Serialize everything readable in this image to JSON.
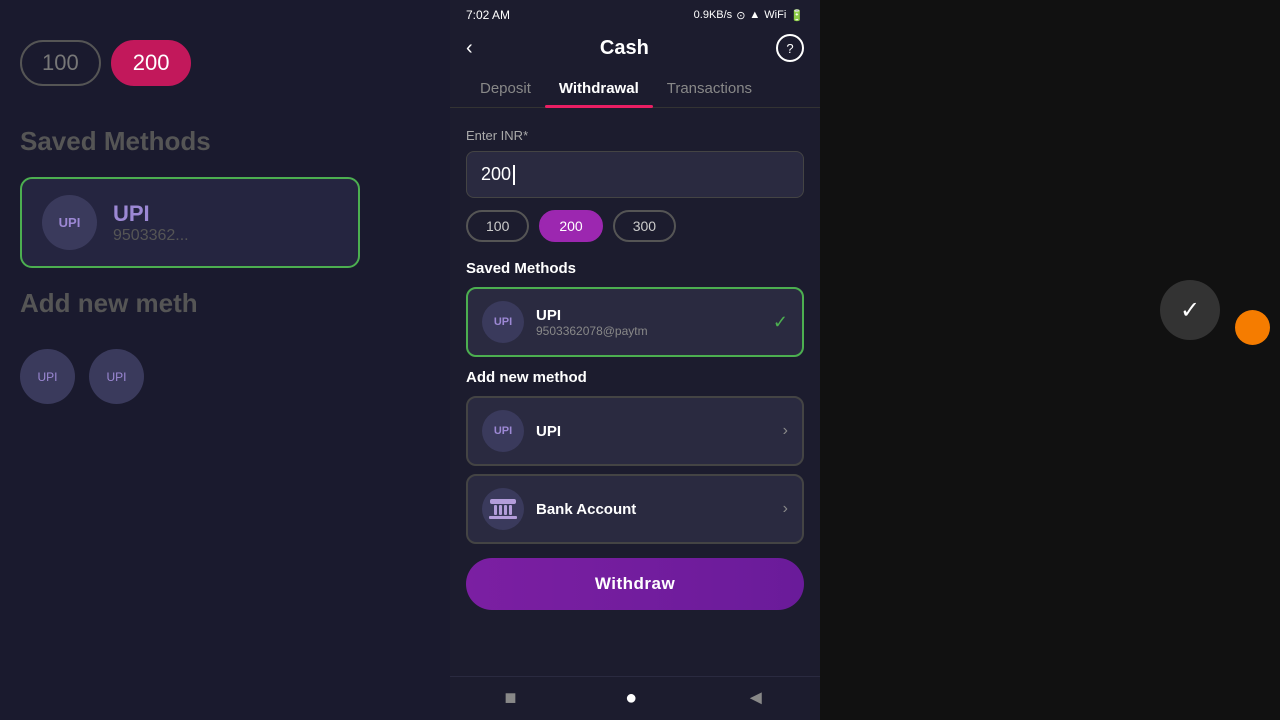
{
  "statusBar": {
    "time": "7:02 AM",
    "network": "0.9KB/s",
    "batteryLevel": "66"
  },
  "header": {
    "title": "Cash",
    "backLabel": "‹",
    "helpLabel": "?"
  },
  "tabs": [
    {
      "label": "Deposit",
      "active": false
    },
    {
      "label": "Withdrawal",
      "active": true
    },
    {
      "label": "Transactions",
      "active": false
    }
  ],
  "form": {
    "amountLabel": "Enter INR*",
    "amountValue": "200",
    "quickAmounts": [
      {
        "value": "100",
        "selected": false
      },
      {
        "value": "200",
        "selected": true
      },
      {
        "value": "300",
        "selected": false
      }
    ]
  },
  "savedMethods": {
    "title": "Saved Methods",
    "items": [
      {
        "icon": "UPI",
        "name": "UPI",
        "sub": "9503362078@paytm",
        "selected": true
      }
    ]
  },
  "addNewMethod": {
    "title": "Add new method",
    "items": [
      {
        "icon": "UPI",
        "name": "UPI",
        "type": "upi"
      },
      {
        "icon": "bank",
        "name": "Bank Account",
        "type": "bank"
      }
    ]
  },
  "withdrawButton": {
    "label": "Withdraw"
  },
  "bottomNav": {
    "items": [
      {
        "icon": "■",
        "label": "stop"
      },
      {
        "icon": "●",
        "label": "home"
      },
      {
        "icon": "◄",
        "label": "back"
      }
    ]
  },
  "background": {
    "savedMethodsLabel": "Saved Methods",
    "addMethodLabel": "Add new meth",
    "amounts": [
      "100",
      "200"
    ]
  }
}
